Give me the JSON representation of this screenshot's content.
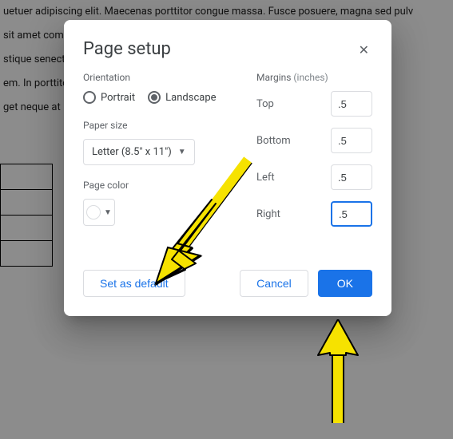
{
  "background": {
    "line1": "uetuer adipiscing elit. Maecenas porttitor congue massa. Fusce posuere, magna sed pulv",
    "line2": "sit amet commodo. Nullam aliquet consequat odio. Vestibulum fusce est. Viva",
    "line3": "stique senectus. Integer accumsan a massa non tincidunt. Donec vitra nonumm",
    "line4": "em. In porttitor arcu et magna volutpat. In id justo tortor scelerisque at, v",
    "line5": "get neque at lorem ipsum dolor."
  },
  "dialog": {
    "title": "Page setup",
    "orientation": {
      "label": "Orientation",
      "portrait": "Portrait",
      "landscape": "Landscape",
      "selected": "landscape"
    },
    "paper_size": {
      "label": "Paper size",
      "value": "Letter (8.5\" x 11\")"
    },
    "page_color": {
      "label": "Page color",
      "value": "#ffffff"
    },
    "margins": {
      "label": "Margins",
      "unit_hint": "(inches)",
      "top_label": "Top",
      "top_value": ".5",
      "bottom_label": "Bottom",
      "bottom_value": ".5",
      "left_label": "Left",
      "left_value": ".5",
      "right_label": "Right",
      "right_value": ".5"
    },
    "buttons": {
      "set_default": "Set as default",
      "cancel": "Cancel",
      "ok": "OK"
    }
  }
}
